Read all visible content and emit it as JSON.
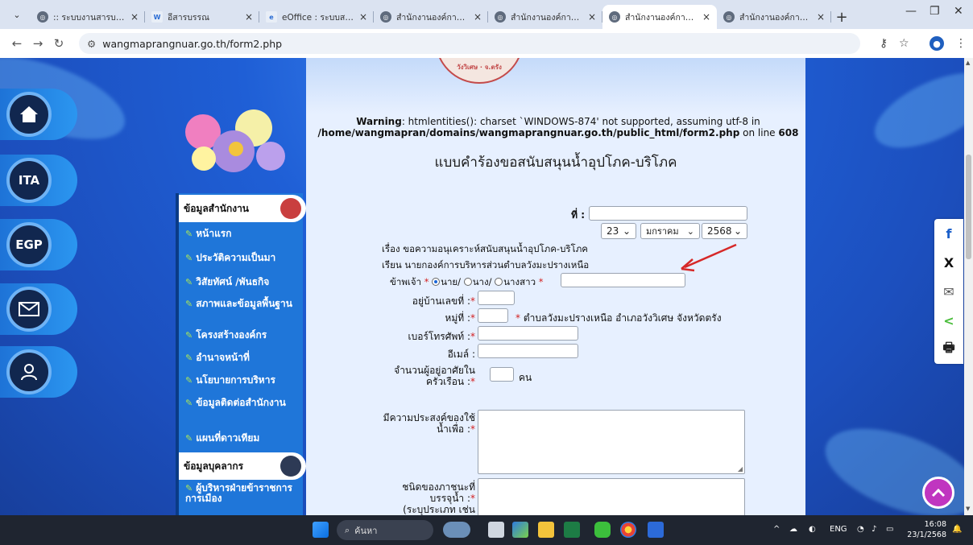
{
  "browser": {
    "tabs": [
      {
        "label": ":: ระบบงานสารบรรณอิเล็กฯ",
        "icon": "globe-icon"
      },
      {
        "label": "อีสารบรรณ",
        "icon": "w-logo-icon"
      },
      {
        "label": "eOffice : ระบบสารบรรณ",
        "icon": "eoffice-icon"
      },
      {
        "label": "สำนักงานองค์การบริหาร",
        "icon": "globe-icon"
      },
      {
        "label": "สำนักงานองค์การบริหาร",
        "icon": "globe-icon"
      },
      {
        "label": "สำนักงานองค์การบริหาร",
        "icon": "globe-icon",
        "active": true
      },
      {
        "label": "สำนักงานองค์การบริหาร",
        "icon": "globe-icon"
      }
    ],
    "url": "wangmaprangnuar.go.th/form2.php"
  },
  "page": {
    "warning": {
      "prefix": "Warning",
      "message": ": htmlentities(): charset `WINDOWS-874' not supported, assuming utf-8 in",
      "path": "/home/wangmapran/domains/wangmaprangnuar.go.th/public_html/form2.php",
      "online": "on line",
      "line": "608"
    },
    "title": "แบบคำร้องขอสนับสนุนน้ำอุปโภค-บริโภค",
    "left_icons": [
      "home-icon",
      "ITA",
      "EGP",
      "mail-icon",
      "user-icon"
    ],
    "sidebar": {
      "section1": "ข้อมูลสำนักงาน",
      "items1": [
        "หน้าแรก",
        "ประวัติความเป็นมา",
        "วิสัยทัศน์ /พันธกิจ",
        "สภาพและข้อมูลพื้นฐาน",
        "โครงสร้างองค์กร",
        "อำนาจหน้าที่",
        "นโยบายการบริหาร",
        "ข้อมูลติดต่อสำนักงาน",
        "แผนที่ดาวเทียม"
      ],
      "section2": "ข้อมูลบุคลากร",
      "items2": [
        "ผู้บริหารฝ่ายข้าราชการการเมือง"
      ]
    },
    "form": {
      "no_label": "ที่ :",
      "day": "23",
      "month": "มกราคม",
      "year": "2568",
      "subject": "เรื่อง ขอความอนุเคราะห์สนับสนุนน้ำอุปโภค-บริโภค",
      "to": "เรียน นายกองค์การบริหารส่วนตำบลวังมะปรางเหนือ",
      "i_label": "ข้าพเจ้า",
      "title_options": [
        "นาย/",
        "นาง/",
        "นางสาว"
      ],
      "title_selected": "นาย/",
      "house_label": "อยู่บ้านเลขที่ :",
      "moo_label": "หมู่ที่ :",
      "address_text": "ตำบลวังมะปรางเหนือ อำเภอวังวิเศษ จังหวัดตรัง",
      "phone_label": "เบอร์โทรศัพท์ :",
      "email_label": "อีเมล์ :",
      "household_label_1": "จำนวนผู้อยู่อาศัยใน",
      "household_label_2": "ครัวเรือน :",
      "household_unit": "คน",
      "purpose_label_1": "มีความประสงค์ของใช้",
      "purpose_label_2": "น้ำเพื่อ :",
      "container_label_1": "ชนิดของภาชนะที่",
      "container_label_2": "บรรจุน้ำ :",
      "container_label_3": "(ระบุประเภท เช่น",
      "required_mark": "*"
    }
  },
  "share": [
    "f",
    "X",
    "✉",
    "<",
    "🖶"
  ],
  "taskbar": {
    "search_placeholder": "ค้นหา",
    "lang": "ENG",
    "time": "16:08",
    "date": "23/1/2568"
  },
  "colors": {
    "accent": "#1f5fd6",
    "required": "#d32020",
    "annotation_arrow": "#d62828"
  }
}
